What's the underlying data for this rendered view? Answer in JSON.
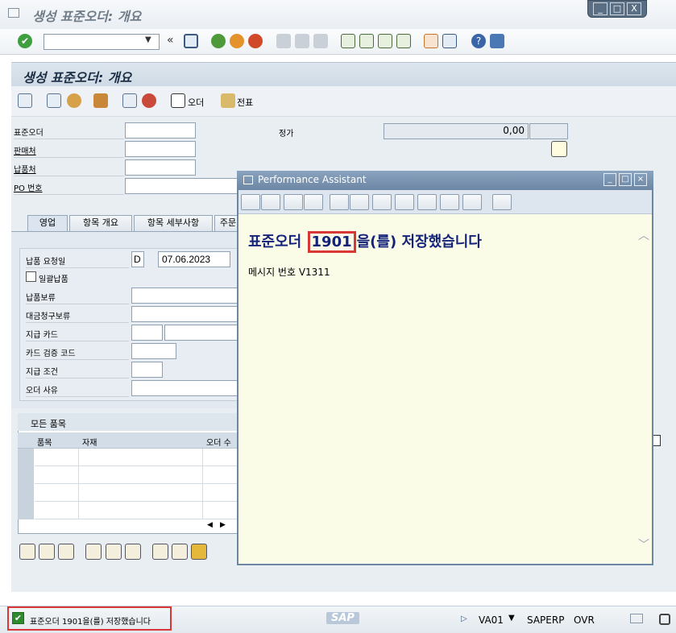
{
  "window": {
    "title": "생성 표준오더: 개요",
    "buttons": [
      "_",
      "□",
      "X"
    ]
  },
  "toolbar": {
    "command_value": "",
    "icons": [
      "enter-icon",
      "save-icon",
      "back-icon",
      "exit-icon",
      "cancel-icon",
      "print-icon",
      "find-icon",
      "find-next-icon",
      "first-page-icon",
      "prev-page-icon",
      "next-page-icon",
      "last-page-icon",
      "new-session-icon",
      "shortcut-icon",
      "help-icon",
      "customize-icon"
    ]
  },
  "screen": {
    "title": "생성 표준오더: 개요",
    "app_toolbar": {
      "order_label": "오더",
      "voucher_label": "전표"
    }
  },
  "header": {
    "fields": [
      {
        "label": "표준오더",
        "value": "",
        "underline": false
      },
      {
        "label": "판매처",
        "value": "",
        "underline": true
      },
      {
        "label": "납품처",
        "value": "",
        "underline": true
      },
      {
        "label": "PO 번호",
        "value": "",
        "underline": true
      }
    ],
    "net_value_label": "정가",
    "net_value": "0,00",
    "currency": ""
  },
  "tabs": [
    "영업",
    "항목 개요",
    "항목 세부사항",
    "주문"
  ],
  "sales_tab": {
    "delivery_date_label": "납품 요청일",
    "delivery_date_type": "D",
    "delivery_date": "07.06.2023",
    "complete_delivery_label": "일괄납품",
    "fields": [
      {
        "label": "납품보류",
        "value": ""
      },
      {
        "label": "대금청구보류",
        "value": ""
      },
      {
        "label": "지급 카드",
        "value": ""
      },
      {
        "label": "카드 검증 코드",
        "value": ""
      },
      {
        "label": "지급 조건",
        "value": ""
      },
      {
        "label": "오더 사유",
        "value": ""
      }
    ]
  },
  "items_table": {
    "title": "모든 품목",
    "columns": [
      "품목",
      "자재",
      "오더 수"
    ]
  },
  "status": {
    "message": "표준오더 1901을(를) 저장했습니다",
    "transaction": "VA01",
    "system": "SAPERP",
    "mode": "OVR",
    "logo": "SAP"
  },
  "performance_assistant": {
    "title": "Performance Assistant",
    "message_prefix": "표준오더 ",
    "order_number": "1901",
    "message_suffix": "을(를) 저장했습니다",
    "message_number": "메시지 번호 V1311"
  }
}
